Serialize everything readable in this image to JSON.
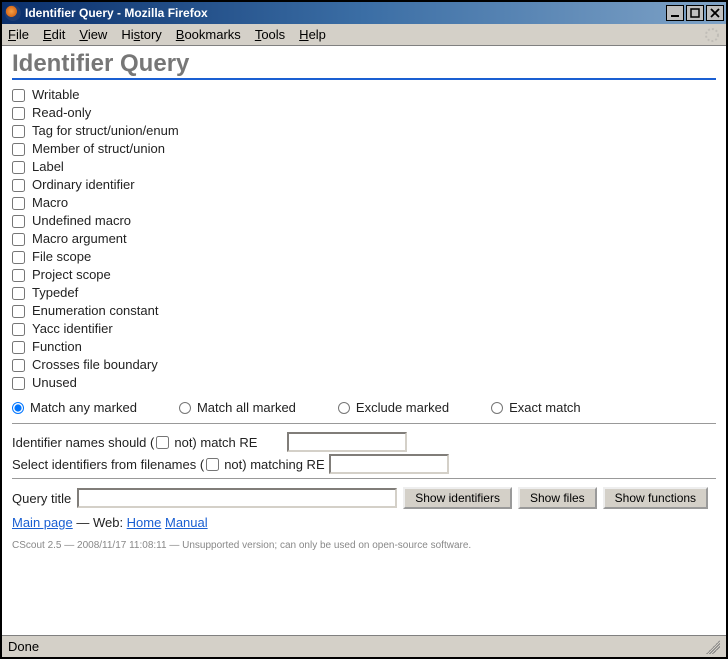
{
  "window": {
    "title": "Identifier Query - Mozilla Firefox"
  },
  "menubar": {
    "items": [
      {
        "label": "File",
        "accel": "F"
      },
      {
        "label": "Edit",
        "accel": "E"
      },
      {
        "label": "View",
        "accel": "V"
      },
      {
        "label": "History",
        "accel": "Hi",
        "raw": "History"
      },
      {
        "label": "Bookmarks",
        "accel": "B"
      },
      {
        "label": "Tools",
        "accel": "T"
      },
      {
        "label": "Help",
        "accel": "H"
      }
    ]
  },
  "page": {
    "heading": "Identifier Query",
    "checkboxes": [
      "Writable",
      "Read-only",
      "Tag for struct/union/enum",
      "Member of struct/union",
      "Label",
      "Ordinary identifier",
      "Macro",
      "Undefined macro",
      "Macro argument",
      "File scope",
      "Project scope",
      "Typedef",
      "Enumeration constant",
      "Yacc identifier",
      "Function",
      "Crosses file boundary",
      "Unused"
    ],
    "radios": {
      "selected": 0,
      "options": [
        "Match any marked",
        "Match all marked",
        "Exclude marked",
        "Exact match"
      ]
    },
    "re1": {
      "prefix": "Identifier names should (",
      "not": " not) match RE",
      "value": ""
    },
    "re2": {
      "prefix": "Select identifiers from filenames (",
      "not": " not) matching RE",
      "value": ""
    },
    "query_title_label": "Query title",
    "query_title_value": "",
    "buttons": {
      "show_identifiers": "Show identifiers",
      "show_files": "Show files",
      "show_functions": "Show functions"
    },
    "links": {
      "main_page": "Main page",
      "sep1": " — Web: ",
      "home": "Home",
      "manual": "Manual"
    },
    "footer": "CScout 2.5 — 2008/11/17 11:08:11 — Unsupported version; can only be used on open-source software."
  },
  "statusbar": {
    "text": "Done"
  }
}
